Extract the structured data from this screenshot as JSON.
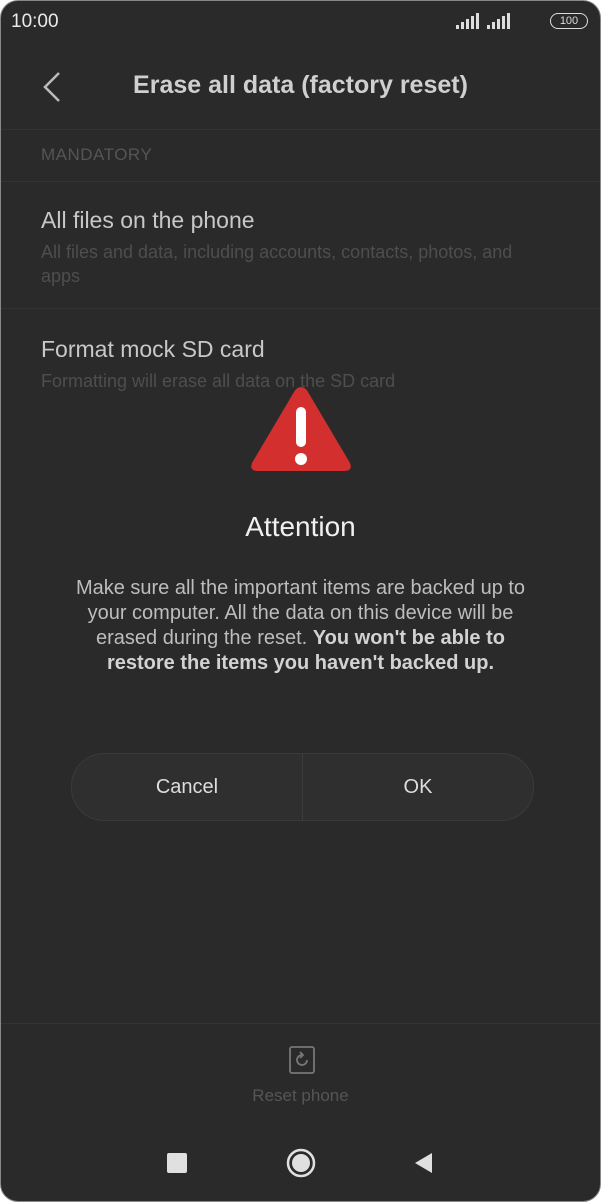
{
  "status": {
    "time": "10:00",
    "battery": "100"
  },
  "header": {
    "title": "Erase all data (factory reset)"
  },
  "section": {
    "label": "MANDATORY"
  },
  "items": [
    {
      "title": "All files on the phone",
      "desc": "All files and data, including accounts, contacts, photos, and apps"
    },
    {
      "title": "Format mock SD card",
      "desc": "Formatting will erase all data on the SD card"
    }
  ],
  "dialog": {
    "title": "Attention",
    "message": "Make sure all the important items are backed up to your computer. All the data on this device will be erased during the reset.",
    "message_bold": "You won't be able to restore the items you haven't backed up.",
    "cancel": "Cancel",
    "ok": "OK",
    "icon": "warning-icon",
    "icon_color": "#d32f2f"
  },
  "bottom": {
    "reset_label": "Reset phone"
  },
  "nav": {
    "icons": [
      "recents-icon",
      "home-icon",
      "back-icon"
    ]
  }
}
